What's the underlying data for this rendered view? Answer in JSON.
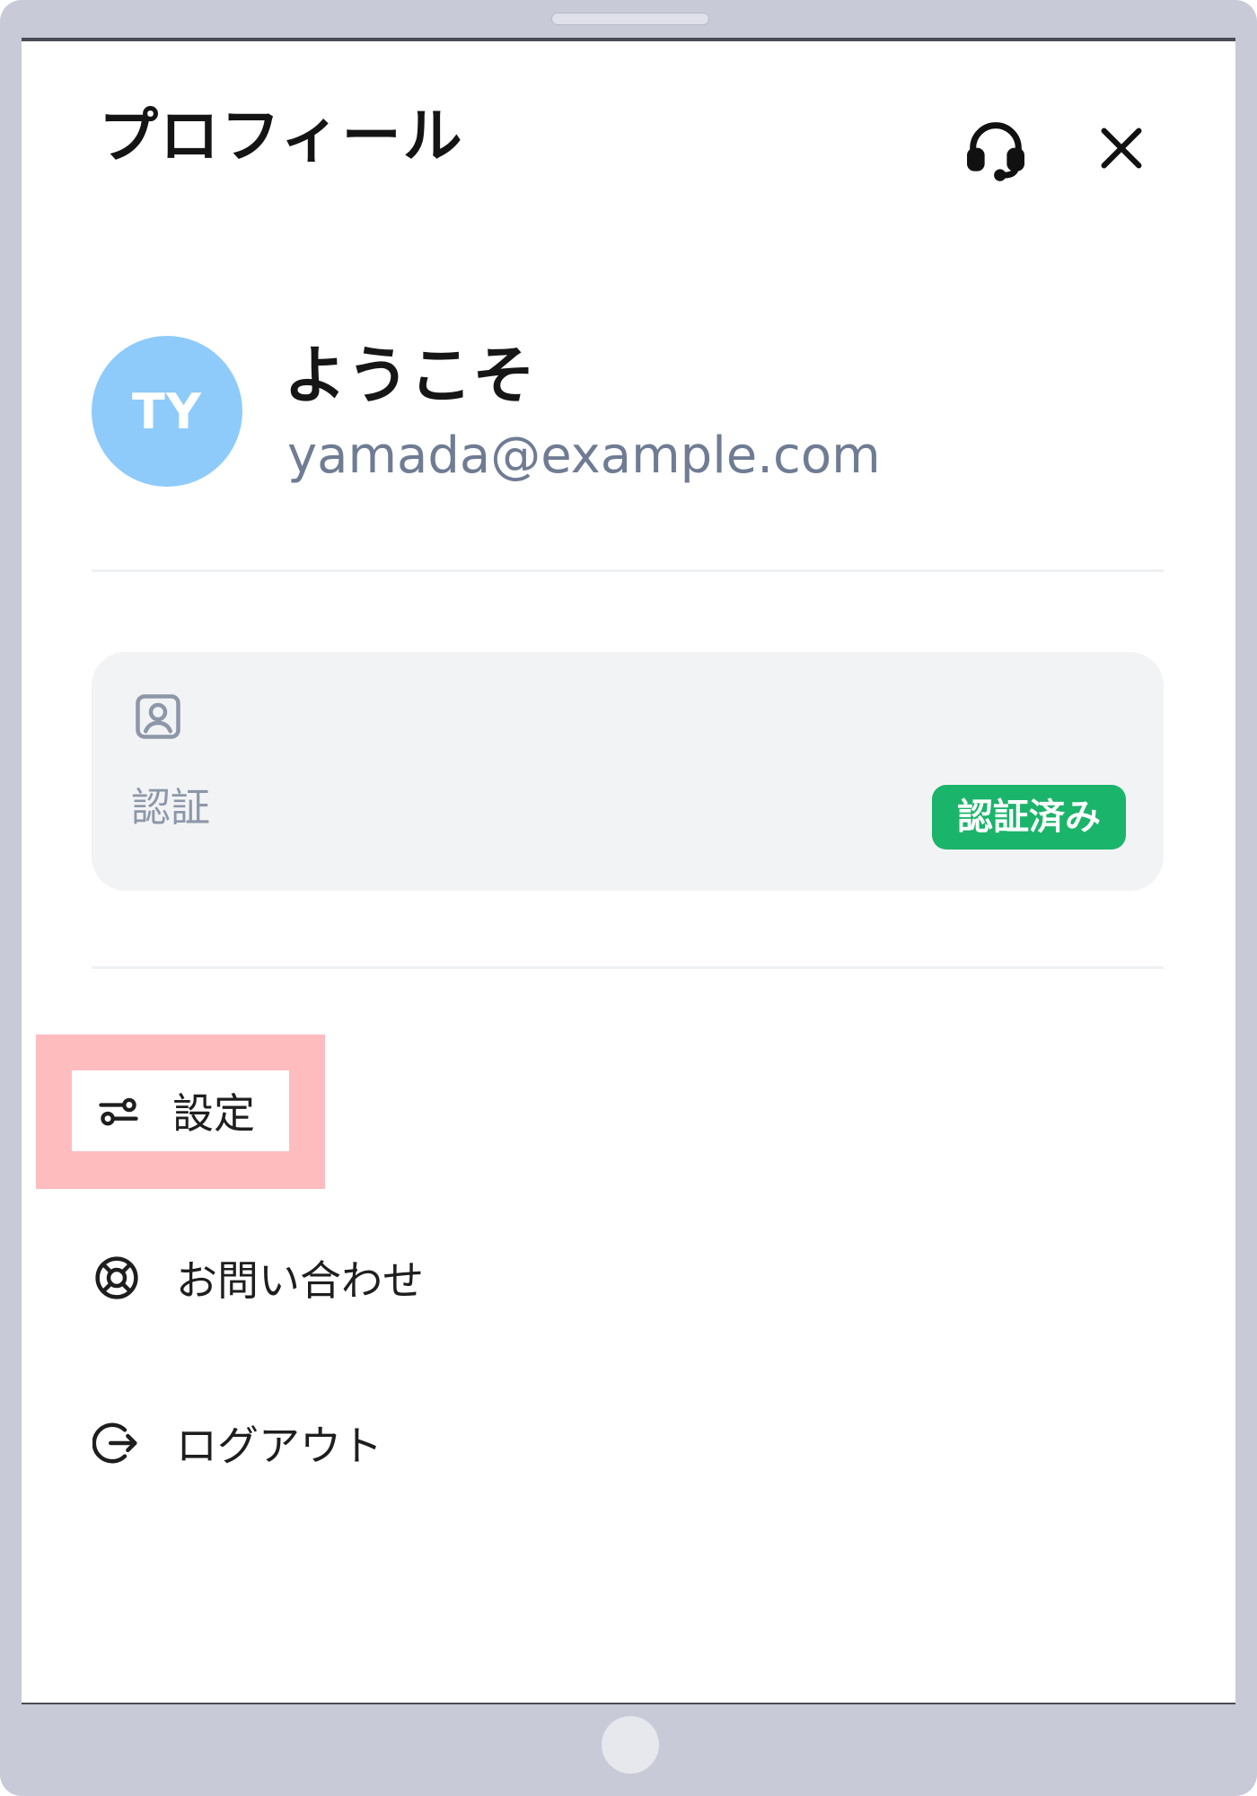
{
  "header": {
    "title": "プロフィール",
    "support_icon": "headset-icon",
    "close_icon": "close-icon"
  },
  "user": {
    "initials": "TY",
    "greeting": "ようこそ",
    "email": "yamada@example.com",
    "avatar_color": "#8ecbfb"
  },
  "verification": {
    "icon": "id-card-icon",
    "label": "認証",
    "status_badge": "認証済み",
    "badge_color": "#1bb46b"
  },
  "menu": {
    "items": [
      {
        "label": "設定",
        "icon": "sliders-icon",
        "highlighted": true
      },
      {
        "label": "お問い合わせ",
        "icon": "lifebuoy-icon"
      },
      {
        "label": "ログアウト",
        "icon": "logout-icon"
      }
    ]
  },
  "colors": {
    "highlight": "#ffbcbf",
    "device_frame": "#c9cad8",
    "email_text": "#6f7c93"
  }
}
